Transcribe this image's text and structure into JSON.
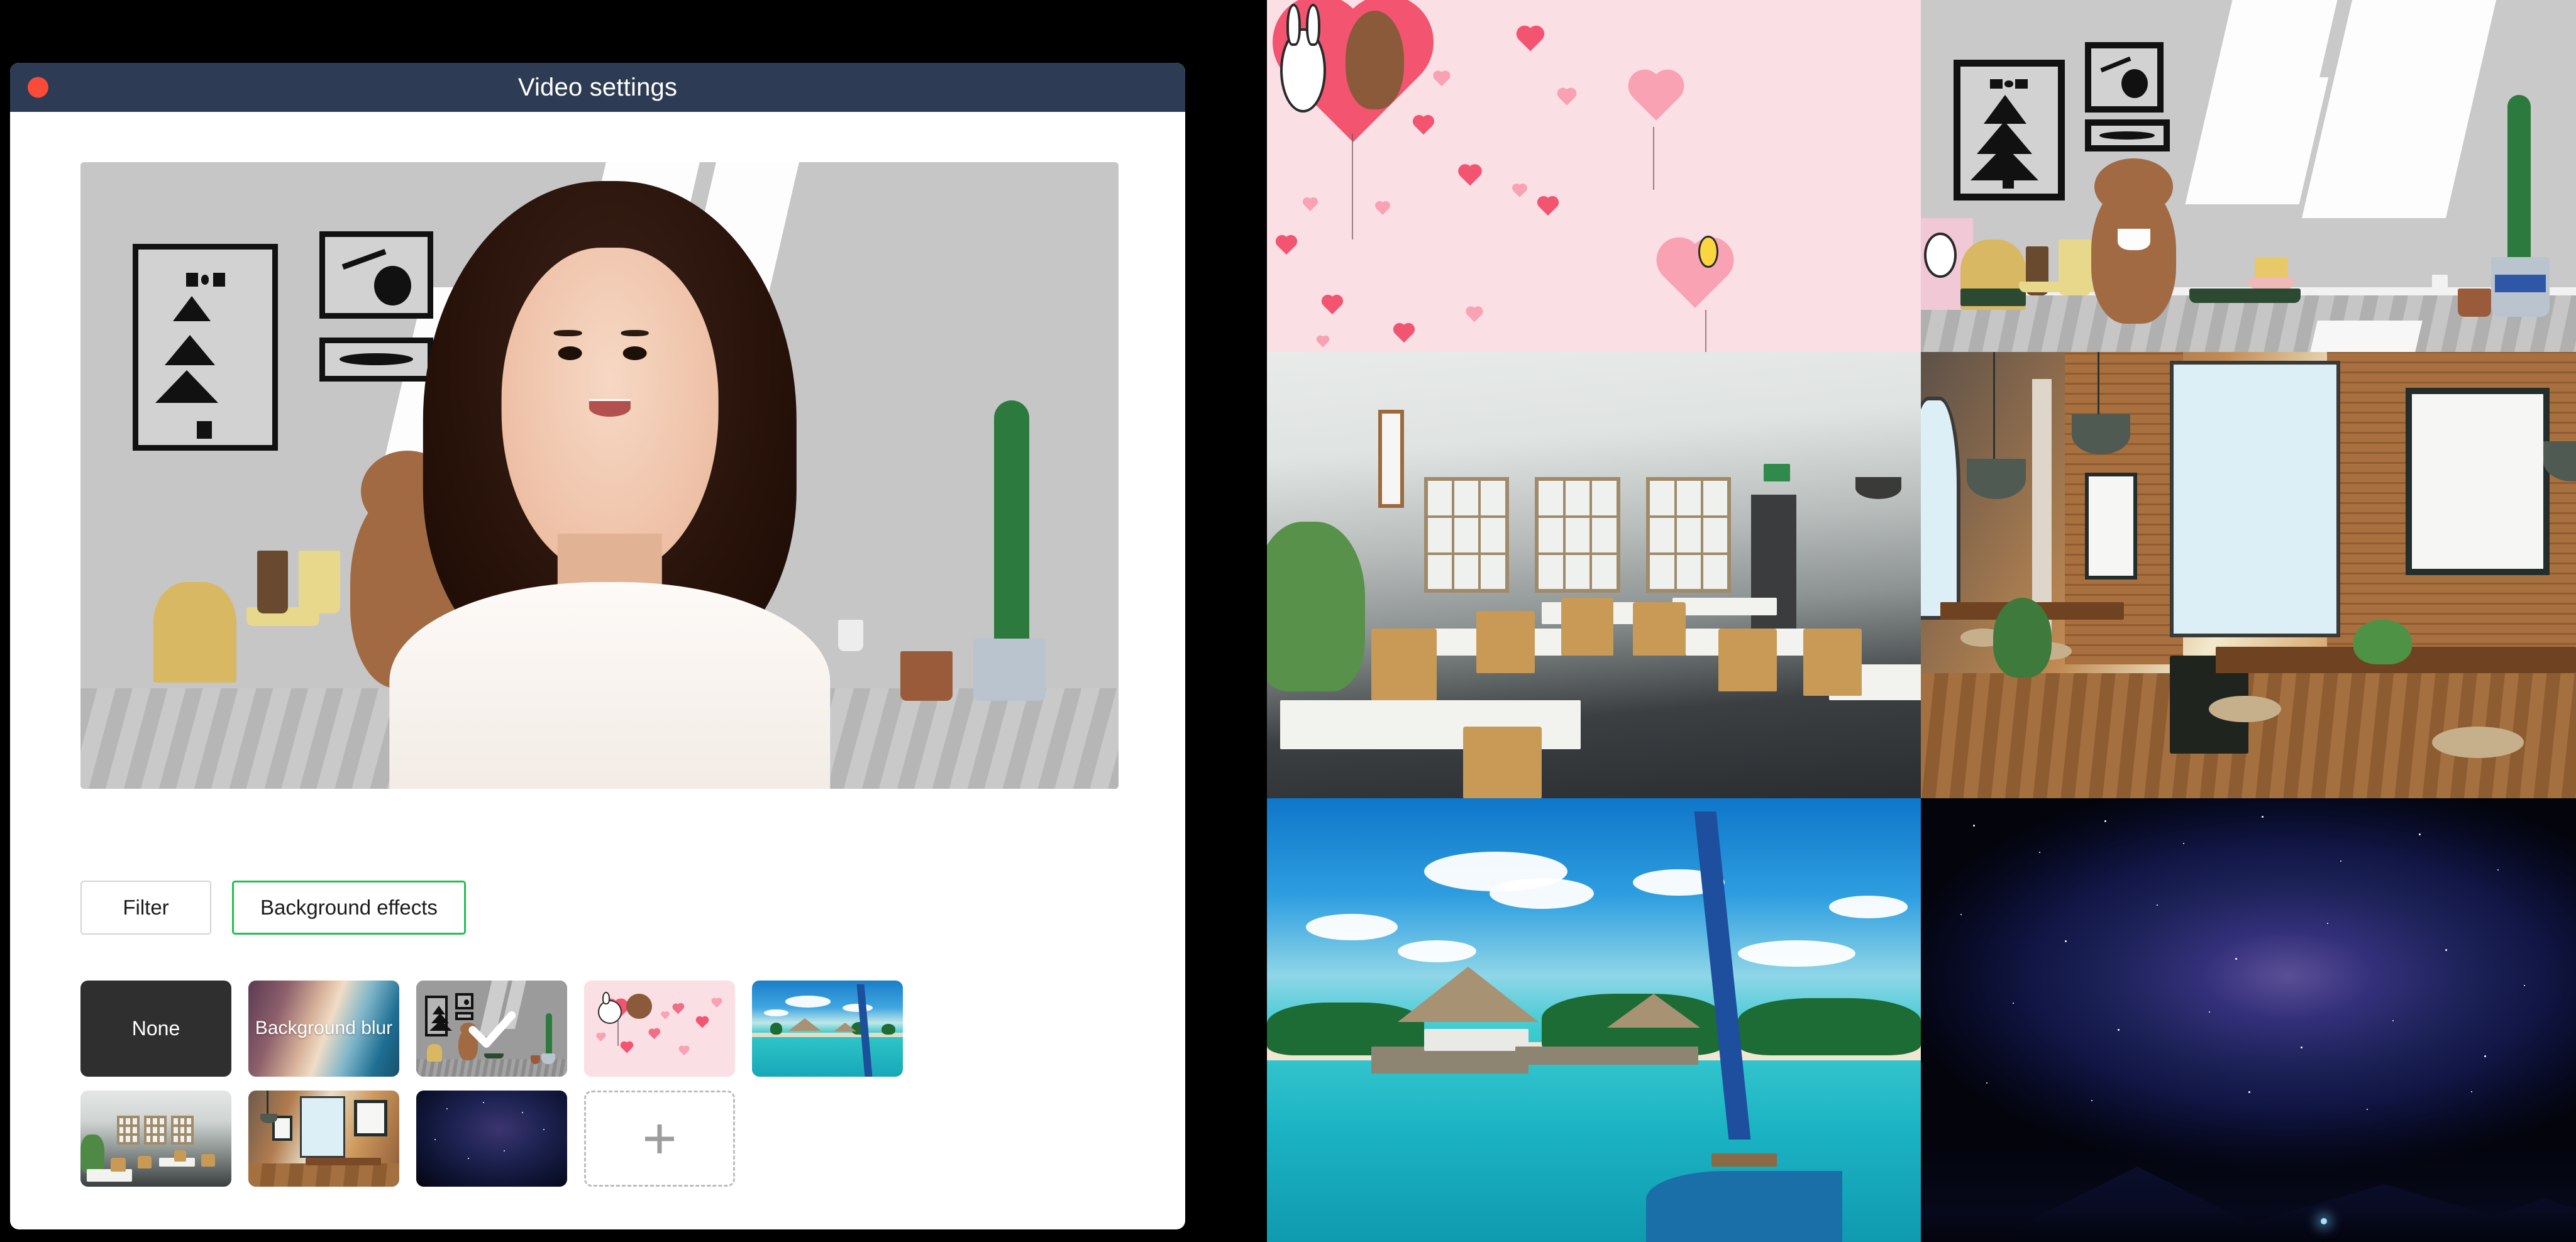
{
  "window": {
    "title": "Video settings",
    "close_icon": "close-dot-icon",
    "titlebar_color": "#2d3c54",
    "close_color": "#fa4b38"
  },
  "preview": {
    "label": "video-preview",
    "description": "Live webcam preview of a smiling woman with a cartoon bear room virtual background applied"
  },
  "tabs": [
    {
      "label": "Filter",
      "active": false
    },
    {
      "label": "Background effects",
      "active": true
    }
  ],
  "accent_color": "#1fc04c",
  "effects": [
    {
      "id": "none",
      "label": "None",
      "kind": "solid",
      "selected": false
    },
    {
      "id": "blur",
      "label": "Background blur",
      "kind": "gradient",
      "selected": false
    },
    {
      "id": "bear-room",
      "label": "",
      "kind": "image",
      "selected": true
    },
    {
      "id": "pink-hearts",
      "label": "",
      "kind": "image",
      "selected": false
    },
    {
      "id": "tropical-beach",
      "label": "",
      "kind": "image",
      "selected": false
    },
    {
      "id": "grey-cafe",
      "label": "",
      "kind": "image",
      "selected": false
    },
    {
      "id": "brick-cafe",
      "label": "",
      "kind": "image",
      "selected": false
    },
    {
      "id": "night-sky",
      "label": "",
      "kind": "image",
      "selected": false
    },
    {
      "id": "add-custom",
      "label": "+",
      "kind": "add",
      "selected": false
    }
  ],
  "selected_effect_id": "bear-room",
  "background_gallery": [
    {
      "position": "top-left",
      "id": "pink-hearts",
      "name": "Pink hearts with bear and bunny balloon"
    },
    {
      "position": "top-right",
      "id": "bear-room",
      "name": "Cartoon bear living room"
    },
    {
      "position": "middle-left",
      "id": "grey-cafe",
      "name": "Modern grey cafe interior"
    },
    {
      "position": "middle-right",
      "id": "brick-cafe",
      "name": "Brick loft cafe with large windows"
    },
    {
      "position": "bottom-left",
      "id": "tropical-beach",
      "name": "Tropical overwater bungalows"
    },
    {
      "position": "bottom-right",
      "id": "night-sky",
      "name": "Milky Way night sky"
    }
  ],
  "add_button": {
    "icon": "plus-icon",
    "label": "+"
  }
}
